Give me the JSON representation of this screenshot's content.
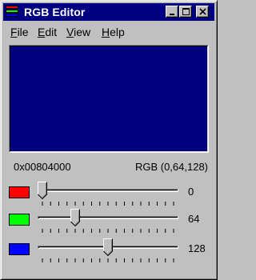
{
  "window": {
    "title": "RGB Editor",
    "controls": {
      "minimize": "minimize-icon",
      "maximize": "maximize-icon",
      "close": "close-icon"
    }
  },
  "menu": {
    "items": [
      {
        "label": "File",
        "accel": "F",
        "rest": "ile"
      },
      {
        "label": "Edit",
        "accel": "E",
        "rest": "dit"
      },
      {
        "label": "View",
        "accel": "V",
        "rest": "iew"
      },
      {
        "label": "Help",
        "accel": "H",
        "rest": "elp"
      }
    ]
  },
  "preview": {
    "color": "#000080"
  },
  "readout": {
    "hex": "0x00804000",
    "rgb": "RGB (0,64,128)"
  },
  "channels": [
    {
      "name": "red",
      "swatch_color": "#ff0000",
      "value": 0,
      "value_text": "0",
      "max": 255
    },
    {
      "name": "green",
      "swatch_color": "#00ff00",
      "value": 64,
      "value_text": "64",
      "max": 255
    },
    {
      "name": "blue",
      "swatch_color": "#0000ff",
      "value": 128,
      "value_text": "128",
      "max": 255
    }
  ],
  "colors": {
    "title_bar": "#000080",
    "face": "#c0c0c0"
  }
}
